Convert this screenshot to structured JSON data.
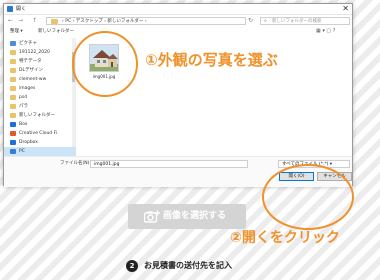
{
  "dialog": {
    "title": "開く",
    "close_glyph": "✕",
    "nav": {
      "back": "←",
      "forward": "→",
      "up": "↑"
    },
    "breadcrumbs": "›  PC  ›  デスクトップ  ›  新しいフォルダー  ›",
    "refresh_glyph": "↻",
    "search_placeholder": "新しいフォルダーの検索",
    "search_icon": "search-icon",
    "commands": {
      "organize": "整理 ▾",
      "new_folder": "新しいフォルダー"
    },
    "view_controls": "▦ ▾  ▢  ?",
    "sidebar": {
      "items": [
        {
          "label": "ピクチャ",
          "icon": "pictures-icon",
          "color": "#4a90d9"
        },
        {
          "label": "191122_2020",
          "icon": "folder-icon",
          "color": "#e9c46a"
        },
        {
          "label": "特テデータ",
          "icon": "folder-icon",
          "color": "#e9c46a"
        },
        {
          "label": "DLデザイン",
          "icon": "folder-icon",
          "color": "#e9c46a"
        },
        {
          "label": "clement-ww",
          "icon": "folder-icon",
          "color": "#e9c46a"
        },
        {
          "label": "images",
          "icon": "folder-icon",
          "color": "#e9c46a"
        },
        {
          "label": "psd",
          "icon": "folder-icon",
          "color": "#e9c46a"
        },
        {
          "label": "パラ",
          "icon": "folder-icon",
          "color": "#e9c46a"
        },
        {
          "label": "新しいフォルダー",
          "icon": "folder-icon",
          "color": "#e9c46a"
        },
        {
          "label": "Box",
          "icon": "box-icon",
          "color": "#1e6fd9"
        },
        {
          "label": "Creative Cloud Fi",
          "icon": "creative-cloud-icon",
          "color": "#e4572e"
        },
        {
          "label": "Dropbox",
          "icon": "dropbox-icon",
          "color": "#1e6fd9"
        },
        {
          "label": "PC",
          "icon": "pc-icon",
          "color": "#3a7bd5"
        }
      ]
    },
    "file": {
      "name": "img001.jpg"
    },
    "filename_label": "ファイル名(N):",
    "filename_value": "img001.jpg",
    "filter_value": "すべてのファイル (*.*)   ▾",
    "open_button": "開く(O)",
    "cancel_button": "キャンセル"
  },
  "callouts": {
    "select_photo": "①外観の写真を選ぶ",
    "click_open": "②開くをクリック"
  },
  "select_image_button": "画像を選択する",
  "step": {
    "number": "2",
    "text": "お見積書の送付先を記入"
  },
  "colors": {
    "accent": "#f0912a",
    "selection": "#cce4f7",
    "primary_button_border": "#0078d7"
  }
}
